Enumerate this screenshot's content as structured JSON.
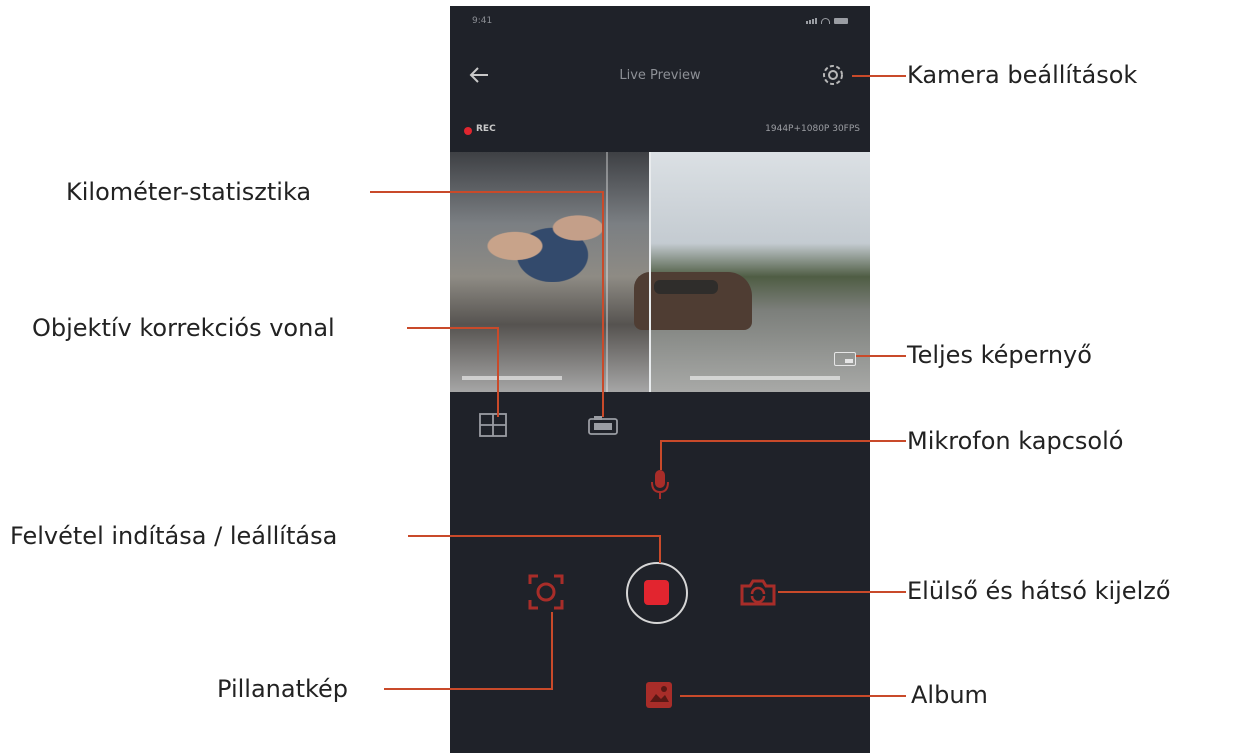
{
  "status_bar": {
    "time": "9:41"
  },
  "header": {
    "title": "Live Preview"
  },
  "record_status": {
    "label": "REC",
    "resolution": "1944P+1080P 30FPS"
  },
  "callouts": {
    "camera_settings": "Kamera beállítások",
    "mileage_stats": "Kilométer-statisztika",
    "lens_correction_line": "Objektív korrekciós vonal",
    "fullscreen": "Teljes képernyő",
    "mic_toggle": "Mikrofon kapcsoló",
    "record_start_stop": "Felvétel indítása / leállítása",
    "front_rear_display": "Elülső és hátsó kijelző",
    "snapshot": "Pillanatkép",
    "album": "Album"
  },
  "colors": {
    "accent": "#e2252f",
    "callout_line": "#c94a2a",
    "app_background": "#1f2229",
    "icon_red": "#b0302c"
  }
}
